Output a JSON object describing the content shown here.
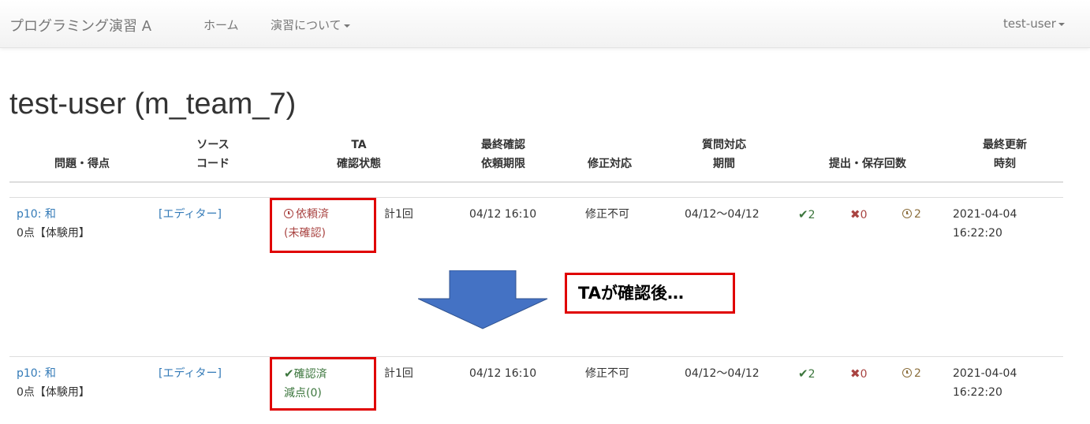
{
  "navbar": {
    "brand": "プログラミング演習 A",
    "home": "ホーム",
    "about": "演習について",
    "user_menu": "test-user"
  },
  "page_title": "test-user (m_team_7)",
  "table": {
    "headers": {
      "problem": "問題・得点",
      "source_1": "ソース",
      "source_2": "コード",
      "ta_1": "TA",
      "ta_2": "確認状態",
      "deadline_1": "最終確認",
      "deadline_2": "依頼期限",
      "fix": "修正対応",
      "qa_1": "質問対応",
      "qa_2": "期間",
      "counts": "提出・保存回数",
      "updated_1": "最終更新",
      "updated_2": "時刻"
    },
    "rows": [
      {
        "problem": "p10: 和",
        "score": "0点【体験用】",
        "editor": "[エディター]",
        "status_icon": "clock-icon",
        "status_line1": "依頼済",
        "status_line2": "(未確認)",
        "status_color": "#a94442",
        "request_count": "計1回",
        "deadline": "04/12 16:10",
        "fix": "修正不可",
        "qa_period": "04/12〜04/12",
        "ok_count": "2",
        "ng_count": "0",
        "save_count": "2",
        "updated_date": "2021-04-04",
        "updated_time": "16:22:20"
      },
      {
        "problem": "p10: 和",
        "score": "0点【体験用】",
        "editor": "[エディター]",
        "status_icon": "check-icon",
        "status_line1": "確認済",
        "status_line2": "減点(0)",
        "status_color": "#3c763d",
        "request_count": "計1回",
        "deadline": "04/12 16:10",
        "fix": "修正不可",
        "qa_period": "04/12〜04/12",
        "ok_count": "2",
        "ng_count": "0",
        "save_count": "2",
        "updated_date": "2021-04-04",
        "updated_time": "16:22:20"
      }
    ]
  },
  "annotation": {
    "callout": "TAが確認後…",
    "highlight_color": "#e00000",
    "arrow_color": "#4472c4"
  }
}
